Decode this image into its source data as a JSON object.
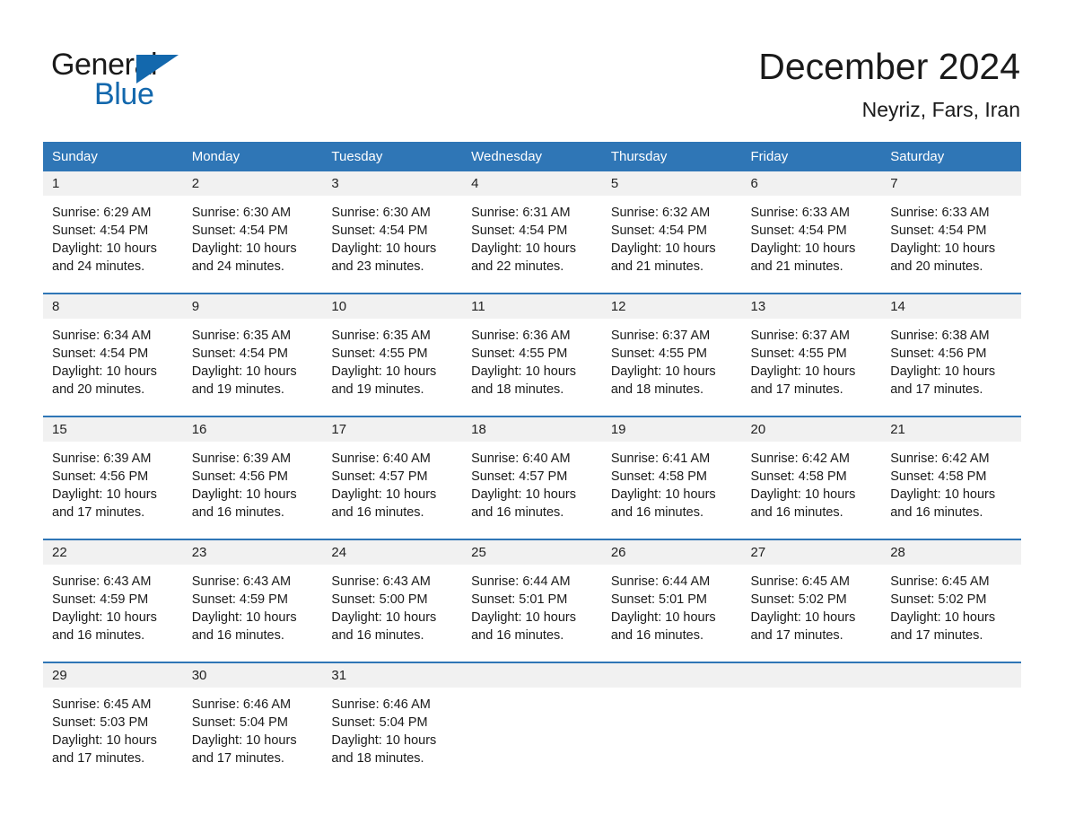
{
  "brand": {
    "line1": "General",
    "line2": "Blue",
    "triangle_color": "#1368ad",
    "icon": "triangle-logo"
  },
  "header": {
    "title": "December 2024",
    "subtitle": "Neyriz, Fars, Iran"
  },
  "theme": {
    "header_blue": "#2f76b6",
    "daynum_gray": "#f1f1f1",
    "text": "#1a1a1a"
  },
  "weekday_headers": [
    "Sunday",
    "Monday",
    "Tuesday",
    "Wednesday",
    "Thursday",
    "Friday",
    "Saturday"
  ],
  "weeks": [
    [
      {
        "day": "1",
        "sunrise": "Sunrise: 6:29 AM",
        "sunset": "Sunset: 4:54 PM",
        "daylight1": "Daylight: 10 hours",
        "daylight2": "and 24 minutes."
      },
      {
        "day": "2",
        "sunrise": "Sunrise: 6:30 AM",
        "sunset": "Sunset: 4:54 PM",
        "daylight1": "Daylight: 10 hours",
        "daylight2": "and 24 minutes."
      },
      {
        "day": "3",
        "sunrise": "Sunrise: 6:30 AM",
        "sunset": "Sunset: 4:54 PM",
        "daylight1": "Daylight: 10 hours",
        "daylight2": "and 23 minutes."
      },
      {
        "day": "4",
        "sunrise": "Sunrise: 6:31 AM",
        "sunset": "Sunset: 4:54 PM",
        "daylight1": "Daylight: 10 hours",
        "daylight2": "and 22 minutes."
      },
      {
        "day": "5",
        "sunrise": "Sunrise: 6:32 AM",
        "sunset": "Sunset: 4:54 PM",
        "daylight1": "Daylight: 10 hours",
        "daylight2": "and 21 minutes."
      },
      {
        "day": "6",
        "sunrise": "Sunrise: 6:33 AM",
        "sunset": "Sunset: 4:54 PM",
        "daylight1": "Daylight: 10 hours",
        "daylight2": "and 21 minutes."
      },
      {
        "day": "7",
        "sunrise": "Sunrise: 6:33 AM",
        "sunset": "Sunset: 4:54 PM",
        "daylight1": "Daylight: 10 hours",
        "daylight2": "and 20 minutes."
      }
    ],
    [
      {
        "day": "8",
        "sunrise": "Sunrise: 6:34 AM",
        "sunset": "Sunset: 4:54 PM",
        "daylight1": "Daylight: 10 hours",
        "daylight2": "and 20 minutes."
      },
      {
        "day": "9",
        "sunrise": "Sunrise: 6:35 AM",
        "sunset": "Sunset: 4:54 PM",
        "daylight1": "Daylight: 10 hours",
        "daylight2": "and 19 minutes."
      },
      {
        "day": "10",
        "sunrise": "Sunrise: 6:35 AM",
        "sunset": "Sunset: 4:55 PM",
        "daylight1": "Daylight: 10 hours",
        "daylight2": "and 19 minutes."
      },
      {
        "day": "11",
        "sunrise": "Sunrise: 6:36 AM",
        "sunset": "Sunset: 4:55 PM",
        "daylight1": "Daylight: 10 hours",
        "daylight2": "and 18 minutes."
      },
      {
        "day": "12",
        "sunrise": "Sunrise: 6:37 AM",
        "sunset": "Sunset: 4:55 PM",
        "daylight1": "Daylight: 10 hours",
        "daylight2": "and 18 minutes."
      },
      {
        "day": "13",
        "sunrise": "Sunrise: 6:37 AM",
        "sunset": "Sunset: 4:55 PM",
        "daylight1": "Daylight: 10 hours",
        "daylight2": "and 17 minutes."
      },
      {
        "day": "14",
        "sunrise": "Sunrise: 6:38 AM",
        "sunset": "Sunset: 4:56 PM",
        "daylight1": "Daylight: 10 hours",
        "daylight2": "and 17 minutes."
      }
    ],
    [
      {
        "day": "15",
        "sunrise": "Sunrise: 6:39 AM",
        "sunset": "Sunset: 4:56 PM",
        "daylight1": "Daylight: 10 hours",
        "daylight2": "and 17 minutes."
      },
      {
        "day": "16",
        "sunrise": "Sunrise: 6:39 AM",
        "sunset": "Sunset: 4:56 PM",
        "daylight1": "Daylight: 10 hours",
        "daylight2": "and 16 minutes."
      },
      {
        "day": "17",
        "sunrise": "Sunrise: 6:40 AM",
        "sunset": "Sunset: 4:57 PM",
        "daylight1": "Daylight: 10 hours",
        "daylight2": "and 16 minutes."
      },
      {
        "day": "18",
        "sunrise": "Sunrise: 6:40 AM",
        "sunset": "Sunset: 4:57 PM",
        "daylight1": "Daylight: 10 hours",
        "daylight2": "and 16 minutes."
      },
      {
        "day": "19",
        "sunrise": "Sunrise: 6:41 AM",
        "sunset": "Sunset: 4:58 PM",
        "daylight1": "Daylight: 10 hours",
        "daylight2": "and 16 minutes."
      },
      {
        "day": "20",
        "sunrise": "Sunrise: 6:42 AM",
        "sunset": "Sunset: 4:58 PM",
        "daylight1": "Daylight: 10 hours",
        "daylight2": "and 16 minutes."
      },
      {
        "day": "21",
        "sunrise": "Sunrise: 6:42 AM",
        "sunset": "Sunset: 4:58 PM",
        "daylight1": "Daylight: 10 hours",
        "daylight2": "and 16 minutes."
      }
    ],
    [
      {
        "day": "22",
        "sunrise": "Sunrise: 6:43 AM",
        "sunset": "Sunset: 4:59 PM",
        "daylight1": "Daylight: 10 hours",
        "daylight2": "and 16 minutes."
      },
      {
        "day": "23",
        "sunrise": "Sunrise: 6:43 AM",
        "sunset": "Sunset: 4:59 PM",
        "daylight1": "Daylight: 10 hours",
        "daylight2": "and 16 minutes."
      },
      {
        "day": "24",
        "sunrise": "Sunrise: 6:43 AM",
        "sunset": "Sunset: 5:00 PM",
        "daylight1": "Daylight: 10 hours",
        "daylight2": "and 16 minutes."
      },
      {
        "day": "25",
        "sunrise": "Sunrise: 6:44 AM",
        "sunset": "Sunset: 5:01 PM",
        "daylight1": "Daylight: 10 hours",
        "daylight2": "and 16 minutes."
      },
      {
        "day": "26",
        "sunrise": "Sunrise: 6:44 AM",
        "sunset": "Sunset: 5:01 PM",
        "daylight1": "Daylight: 10 hours",
        "daylight2": "and 16 minutes."
      },
      {
        "day": "27",
        "sunrise": "Sunrise: 6:45 AM",
        "sunset": "Sunset: 5:02 PM",
        "daylight1": "Daylight: 10 hours",
        "daylight2": "and 17 minutes."
      },
      {
        "day": "28",
        "sunrise": "Sunrise: 6:45 AM",
        "sunset": "Sunset: 5:02 PM",
        "daylight1": "Daylight: 10 hours",
        "daylight2": "and 17 minutes."
      }
    ],
    [
      {
        "day": "29",
        "sunrise": "Sunrise: 6:45 AM",
        "sunset": "Sunset: 5:03 PM",
        "daylight1": "Daylight: 10 hours",
        "daylight2": "and 17 minutes."
      },
      {
        "day": "30",
        "sunrise": "Sunrise: 6:46 AM",
        "sunset": "Sunset: 5:04 PM",
        "daylight1": "Daylight: 10 hours",
        "daylight2": "and 17 minutes."
      },
      {
        "day": "31",
        "sunrise": "Sunrise: 6:46 AM",
        "sunset": "Sunset: 5:04 PM",
        "daylight1": "Daylight: 10 hours",
        "daylight2": "and 18 minutes."
      },
      {
        "day": "",
        "sunrise": "",
        "sunset": "",
        "daylight1": "",
        "daylight2": ""
      },
      {
        "day": "",
        "sunrise": "",
        "sunset": "",
        "daylight1": "",
        "daylight2": ""
      },
      {
        "day": "",
        "sunrise": "",
        "sunset": "",
        "daylight1": "",
        "daylight2": ""
      },
      {
        "day": "",
        "sunrise": "",
        "sunset": "",
        "daylight1": "",
        "daylight2": ""
      }
    ]
  ]
}
